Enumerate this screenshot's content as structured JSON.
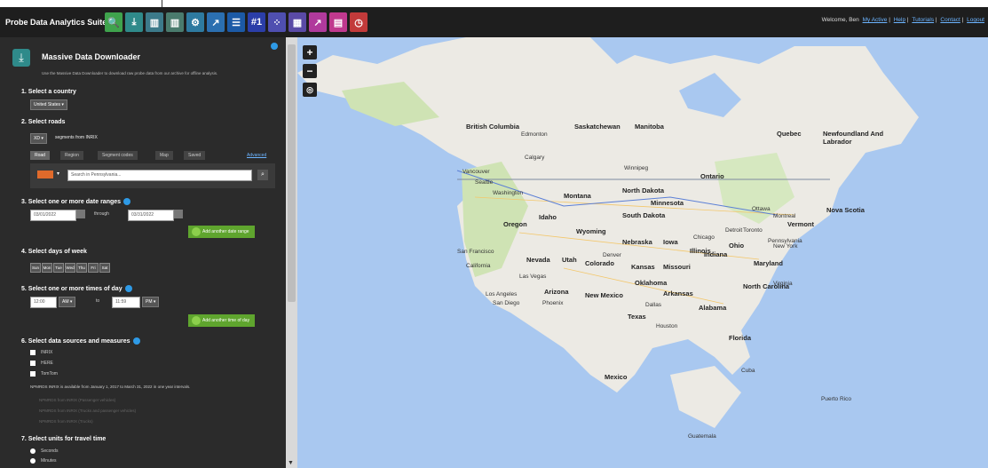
{
  "app": {
    "title": "Probe Data Analytics Suite",
    "welcome_prefix": "Welcome, Ben",
    "welcome_links": [
      "My Active",
      "Help",
      "Tutorials",
      "Contact",
      "Logout"
    ]
  },
  "toolbar": {
    "tools": [
      {
        "icon": "magnifier-icon",
        "color": "#3fa34d",
        "glyph": "🔍"
      },
      {
        "icon": "download-icon",
        "color": "#2f8a8a",
        "glyph": "⤓"
      },
      {
        "icon": "bars-icon",
        "color": "#3c7a8a",
        "glyph": "▥"
      },
      {
        "icon": "columns-icon",
        "color": "#4a7b6d",
        "glyph": "▥"
      },
      {
        "icon": "gear-map-icon",
        "color": "#2e7aa0",
        "glyph": "⚙"
      },
      {
        "icon": "line-chart-icon",
        "color": "#2b6fb0",
        "glyph": "↗"
      },
      {
        "icon": "list-icon",
        "color": "#1c5aa6",
        "glyph": "☰"
      },
      {
        "icon": "rank-icon",
        "color": "#2b3ea8",
        "glyph": "#1"
      },
      {
        "icon": "grid-dots-icon",
        "color": "#4f4fb0",
        "glyph": "⁘"
      },
      {
        "icon": "matrix-icon",
        "color": "#5a4aa6",
        "glyph": "▦"
      },
      {
        "icon": "trend-icon",
        "color": "#b03a9c",
        "glyph": "↗"
      },
      {
        "icon": "table-icon",
        "color": "#c0398e",
        "glyph": "▤"
      },
      {
        "icon": "clock-icon",
        "color": "#c23a3a",
        "glyph": "◷"
      }
    ]
  },
  "panel": {
    "title": "Massive Data Downloader",
    "description": "Use the Massive Data Downloader to download raw probe data from our archive for offline analysis.",
    "step1": {
      "label": "1. Select a country",
      "country": "United States"
    },
    "step2": {
      "label": "2. Select roads",
      "mode": "XD",
      "segments_text": "segments from INRIX",
      "tabs": [
        "Road",
        "Region",
        "Segment codes",
        "Map",
        "Saved"
      ],
      "advanced": "Advanced",
      "search_placeholder": "Search in Pennsylvania..."
    },
    "step3": {
      "label": "3. Select one or more date ranges",
      "from": "03/01/2022",
      "through_label": "through",
      "to": "03/31/2022",
      "add_button": "Add another date range"
    },
    "step4": {
      "label": "4. Select days of week",
      "days": [
        "Sun",
        "Mon",
        "Tue",
        "Wed",
        "Thu",
        "Fri",
        "Sat"
      ]
    },
    "step5": {
      "label": "5. Select one or more times of day",
      "start_time": "12:00",
      "start_ampm": "AM",
      "to_label": "to",
      "end_time": "11:59",
      "end_ampm": "PM",
      "add_button": "Add another time of day"
    },
    "step6": {
      "label": "6. Select data sources and measures",
      "sources": [
        "INRIX",
        "HERE",
        "TomTom"
      ],
      "note": "NPMRDS INRIX is available from January 1, 2017 to March 31, 2022 in one year intervals.",
      "npmrds": [
        "NPMRDS from INRIX (Passenger vehicles)",
        "NPMRDS from INRIX (Trucks and passenger vehicles)",
        "NPMRDS from INRIX (Trucks)"
      ]
    },
    "step7": {
      "label": "7. Select units for travel time",
      "options": [
        "Seconds",
        "Minutes"
      ]
    }
  },
  "map": {
    "labels": {
      "british_columbia": "British Columbia",
      "saskatchewan": "Saskatchewan",
      "manitoba": "Manitoba",
      "quebec": "Quebec",
      "newfoundland": "Newfoundland And Labrador",
      "ontario": "Ontario",
      "north_dakota": "North Dakota",
      "montana": "Montana",
      "washington": "Washington",
      "oregon": "Oregon",
      "idaho": "Idaho",
      "wyoming": "Wyoming",
      "south_dakota": "South Dakota",
      "minnesota": "Minnesota",
      "nevada": "Nevada",
      "utah": "Utah",
      "colorado": "Colorado",
      "nebraska": "Nebraska",
      "kansas": "Kansas",
      "missouri": "Missouri",
      "iowa": "Iowa",
      "illinois": "Illinois",
      "indiana": "Indiana",
      "ohio": "Ohio",
      "california": "California",
      "arizona": "Arizona",
      "new_mexico": "New Mexico",
      "oklahoma": "Oklahoma",
      "arkansas": "Arkansas",
      "texas": "Texas",
      "alabama": "Alabama",
      "florida": "Florida",
      "north_carolina": "North Carolina",
      "virginia": "Virginia",
      "maryland": "Maryland",
      "pennsylvania": "Pennsylvania",
      "new_york": "New York",
      "vermont": "Vermont",
      "nova_scotia": "Nova Scotia",
      "ottawa": "Ottawa",
      "montreal": "Montreal",
      "toronto": "Toronto",
      "chicago": "Chicago",
      "detroit": "Detroit",
      "winnipeg": "Winnipeg",
      "calgary": "Calgary",
      "edmonton": "Edmonton",
      "vancouver": "Vancouver",
      "seattle": "Seattle",
      "san_francisco": "San Francisco",
      "los_angeles": "Los Angeles",
      "san_diego": "San Diego",
      "las_vegas": "Las Vegas",
      "phoenix": "Phoenix",
      "denver": "Denver",
      "dallas": "Dallas",
      "houston": "Houston",
      "mexico": "Mexico",
      "cuba": "Cuba",
      "puerto_rico": "Puerto Rico",
      "guatemala": "Guatemala"
    }
  }
}
